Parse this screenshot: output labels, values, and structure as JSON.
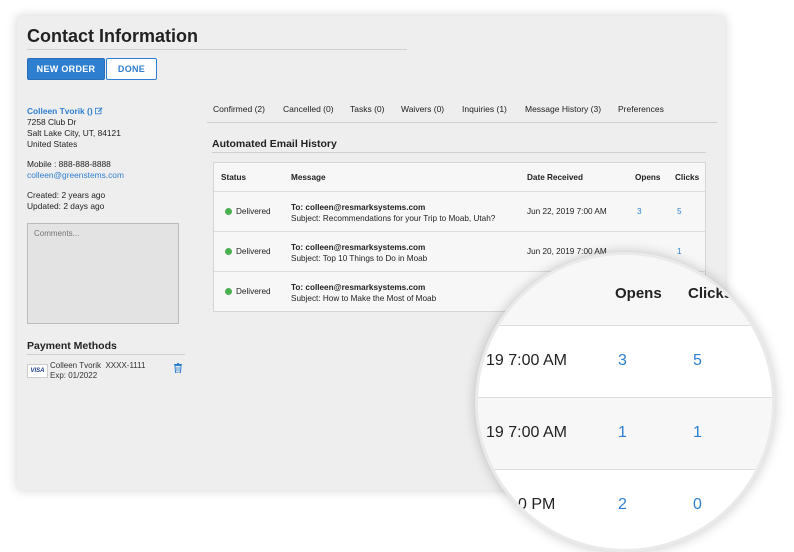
{
  "page": {
    "title": "Contact Information"
  },
  "toolbar": {
    "new_order_label": "NEW ORDER",
    "done_label": "DONE"
  },
  "contact": {
    "name": "Colleen Tvorik ()",
    "address_line1": "7258 Club Dr",
    "address_line2": "Salt Lake City, UT, 84121",
    "country": "United States",
    "mobile": "Mobile : 888-888-8888",
    "email": "colleen@greenstems.com",
    "created": "Created: 2 years ago",
    "updated": "Updated: 2 days ago"
  },
  "comments": {
    "placeholder": "Comments..."
  },
  "payment": {
    "title": "Payment Methods",
    "card_brand": "VISA",
    "holder": "Colleen Tvorik",
    "number": "XXXX-1111",
    "expiry": "Exp: 01/2022"
  },
  "tabs": [
    {
      "label": "Confirmed (2)"
    },
    {
      "label": "Cancelled (0)"
    },
    {
      "label": "Tasks (0)"
    },
    {
      "label": "Waivers (0)"
    },
    {
      "label": "Inquiries (1)"
    },
    {
      "label": "Message History (3)"
    },
    {
      "label": "Preferences"
    }
  ],
  "history": {
    "title": "Automated Email History",
    "columns": {
      "status": "Status",
      "message": "Message",
      "date": "Date Received",
      "opens": "Opens",
      "clicks": "Clicks"
    },
    "rows": [
      {
        "status": "Delivered",
        "to": "To: colleen@resmarksystems.com",
        "subject": "Subject: Recommendations for your Trip to Moab, Utah?",
        "date": "Jun 22, 2019 7:00 AM",
        "opens": "3",
        "clicks": "5"
      },
      {
        "status": "Delivered",
        "to": "To: colleen@resmarksystems.com",
        "subject": "Subject: Top 10 Things to Do in Moab",
        "date": "Jun 20, 2019 7:00 AM",
        "opens": "",
        "clicks": "1"
      },
      {
        "status": "Delivered",
        "to": "To: colleen@resmarksystems.com",
        "subject": "Subject: How to Make the Most of Moab",
        "date": "",
        "opens": "",
        "clicks": ""
      }
    ]
  },
  "magnifier": {
    "opens_header": "Opens",
    "clicks_header": "Clicks",
    "rows": [
      {
        "date": "19 7:00 AM",
        "opens": "3",
        "clicks": "5"
      },
      {
        "date": "19 7:00 AM",
        "opens": "1",
        "clicks": "1"
      },
      {
        "date": "0 PM",
        "opens": "2",
        "clicks": "0"
      }
    ]
  },
  "colors": {
    "accent": "#2f7fd0",
    "delivered": "#4caf50",
    "panel": "#eeeeee"
  }
}
